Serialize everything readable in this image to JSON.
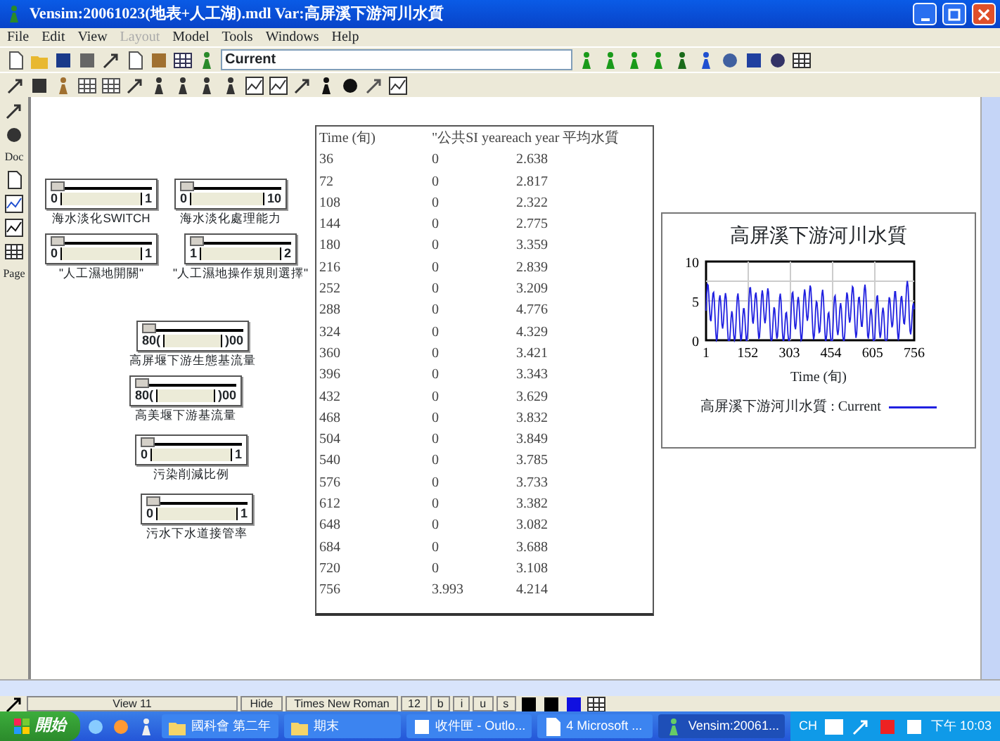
{
  "window": {
    "title": "Vensim:20061023(地表+人工湖).mdl Var:高屏溪下游河川水質"
  },
  "menu": [
    {
      "label": "File",
      "disabled": false
    },
    {
      "label": "Edit",
      "disabled": false
    },
    {
      "label": "View",
      "disabled": false
    },
    {
      "label": "Layout",
      "disabled": true
    },
    {
      "label": "Model",
      "disabled": false
    },
    {
      "label": "Tools",
      "disabled": false
    },
    {
      "label": "Windows",
      "disabled": false
    },
    {
      "label": "Help",
      "disabled": false
    }
  ],
  "run_name": {
    "value": "Current"
  },
  "side_toolbar": {
    "doc_label": "Doc",
    "page_label": "Page"
  },
  "sliders": [
    {
      "label": "海水淡化SWITCH",
      "min": "0",
      "max": "1",
      "level": 0
    },
    {
      "label": "海水淡化處理能力",
      "min": "0",
      "max": "10",
      "level": 0
    },
    {
      "label": "\"人工濕地開關\"",
      "min": "0",
      "max": "1",
      "level": 0
    },
    {
      "label": "\"人工濕地操作規則選擇\"",
      "min": "1",
      "max": "2",
      "level": 0
    },
    {
      "label": "高屏堰下游生態基流量",
      "min": "80(",
      "max": ")00",
      "level": 0
    },
    {
      "label": "高美堰下游基流量",
      "min": "80(",
      "max": ")00",
      "level": 0
    },
    {
      "label": "污染削減比例",
      "min": "0",
      "max": "1",
      "level": 0
    },
    {
      "label": "污水下水道接管率",
      "min": "0",
      "max": "1",
      "level": 0
    }
  ],
  "table": {
    "columns": [
      "Time (旬)",
      "\"公共SI yeareach year 平均水質"
    ],
    "rows": [
      [
        "36",
        "0",
        "2.638"
      ],
      [
        "72",
        "0",
        "2.817"
      ],
      [
        "108",
        "0",
        "2.322"
      ],
      [
        "144",
        "0",
        "2.775"
      ],
      [
        "180",
        "0",
        "3.359"
      ],
      [
        "216",
        "0",
        "2.839"
      ],
      [
        "252",
        "0",
        "3.209"
      ],
      [
        "288",
        "0",
        "4.776"
      ],
      [
        "324",
        "0",
        "4.329"
      ],
      [
        "360",
        "0",
        "3.421"
      ],
      [
        "396",
        "0",
        "3.343"
      ],
      [
        "432",
        "0",
        "3.629"
      ],
      [
        "468",
        "0",
        "3.832"
      ],
      [
        "504",
        "0",
        "3.849"
      ],
      [
        "540",
        "0",
        "3.785"
      ],
      [
        "576",
        "0",
        "3.733"
      ],
      [
        "612",
        "0",
        "3.382"
      ],
      [
        "648",
        "0",
        "3.082"
      ],
      [
        "684",
        "0",
        "3.688"
      ],
      [
        "720",
        "0",
        "3.108"
      ],
      [
        "756",
        "3.993",
        "4.214"
      ]
    ]
  },
  "graph": {
    "title": "高屏溪下游河川水質",
    "yticks": [
      "10",
      "5",
      "0"
    ],
    "xticks": [
      "1",
      "152",
      "303",
      "454",
      "605",
      "756"
    ],
    "xlabel": "Time (旬)",
    "legend": "高屏溪下游河川水質 : Current"
  },
  "status_bar": {
    "view": "View 11",
    "hide": "Hide",
    "font": "Times New Roman",
    "size": "12",
    "styles": [
      "b",
      "i",
      "u",
      "s"
    ]
  },
  "taskbar": {
    "start": "開始",
    "tasks": [
      {
        "label": "國科會 第二年",
        "kind": "folder",
        "selected": false
      },
      {
        "label": "期末",
        "kind": "folder",
        "selected": false
      },
      {
        "label": "收件匣 - Outlo...",
        "kind": "mail",
        "selected": false
      },
      {
        "label": "4 Microsoft ...",
        "kind": "word",
        "selected": false
      },
      {
        "label": "Vensim:20061...",
        "kind": "app",
        "selected": true
      }
    ],
    "lang": "CH",
    "clock": "下午 10:03"
  }
}
